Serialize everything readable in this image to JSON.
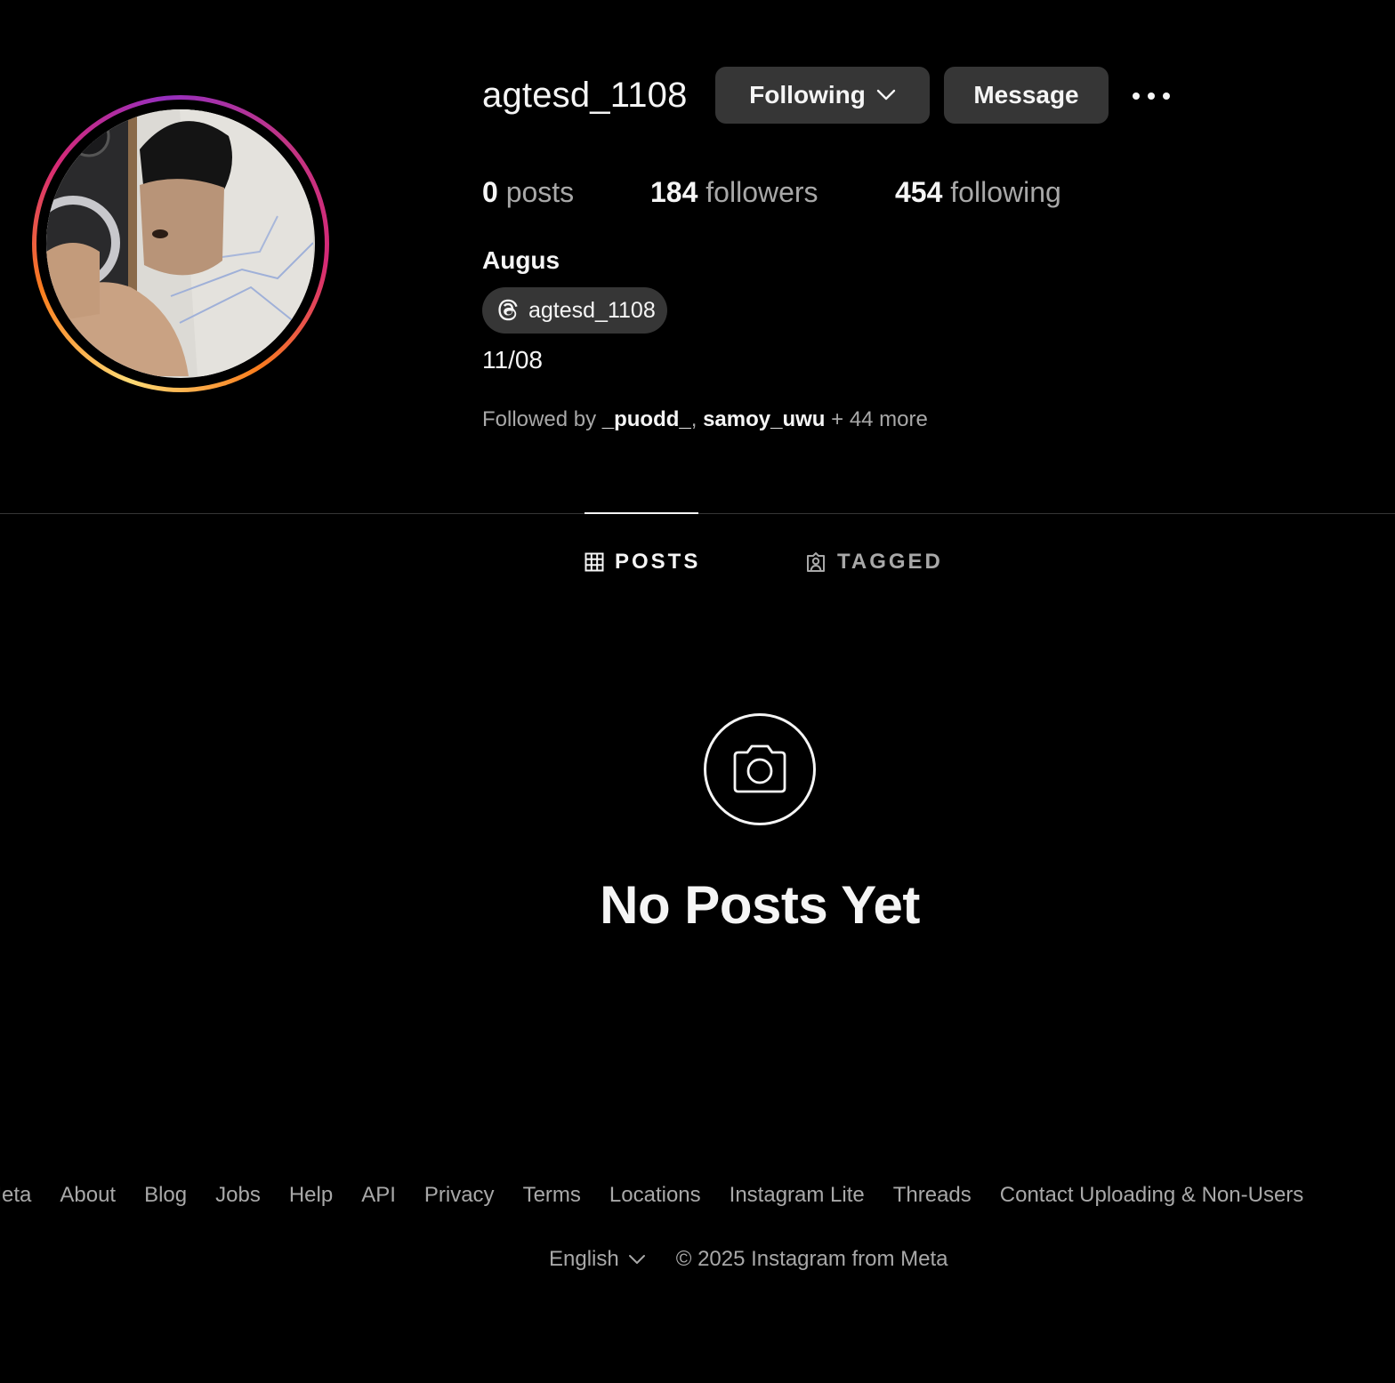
{
  "profile": {
    "username": "agtesd_1108",
    "following_button": "Following",
    "message_button": "Message",
    "stats": {
      "posts_count": "0",
      "posts_label": "posts",
      "followers_count": "184",
      "followers_label": "followers",
      "following_count": "454",
      "following_label": "following"
    },
    "full_name": "Augus",
    "threads_handle": "agtesd_1108",
    "bio": "11/08",
    "followed_by": {
      "prefix": "Followed by ",
      "user1": "_puodd_",
      "separator": ", ",
      "user2": "samoy_uwu",
      "suffix": " + 44 more"
    }
  },
  "tabs": [
    {
      "label": "POSTS",
      "icon": "grid-icon",
      "active": true
    },
    {
      "label": "TAGGED",
      "icon": "tagged-icon",
      "active": false
    }
  ],
  "empty_state": {
    "icon": "camera-icon",
    "title": "No Posts Yet"
  },
  "footer": {
    "links": [
      "Meta",
      "About",
      "Blog",
      "Jobs",
      "Help",
      "API",
      "Privacy",
      "Terms",
      "Locations",
      "Instagram Lite",
      "Threads",
      "Contact Uploading & Non-Users"
    ],
    "language": "English",
    "copyright": "© 2025 Instagram from Meta"
  },
  "colors": {
    "background": "#000000",
    "button": "#363636",
    "text_primary": "#f5f5f5",
    "text_secondary": "#a8a8a8"
  }
}
